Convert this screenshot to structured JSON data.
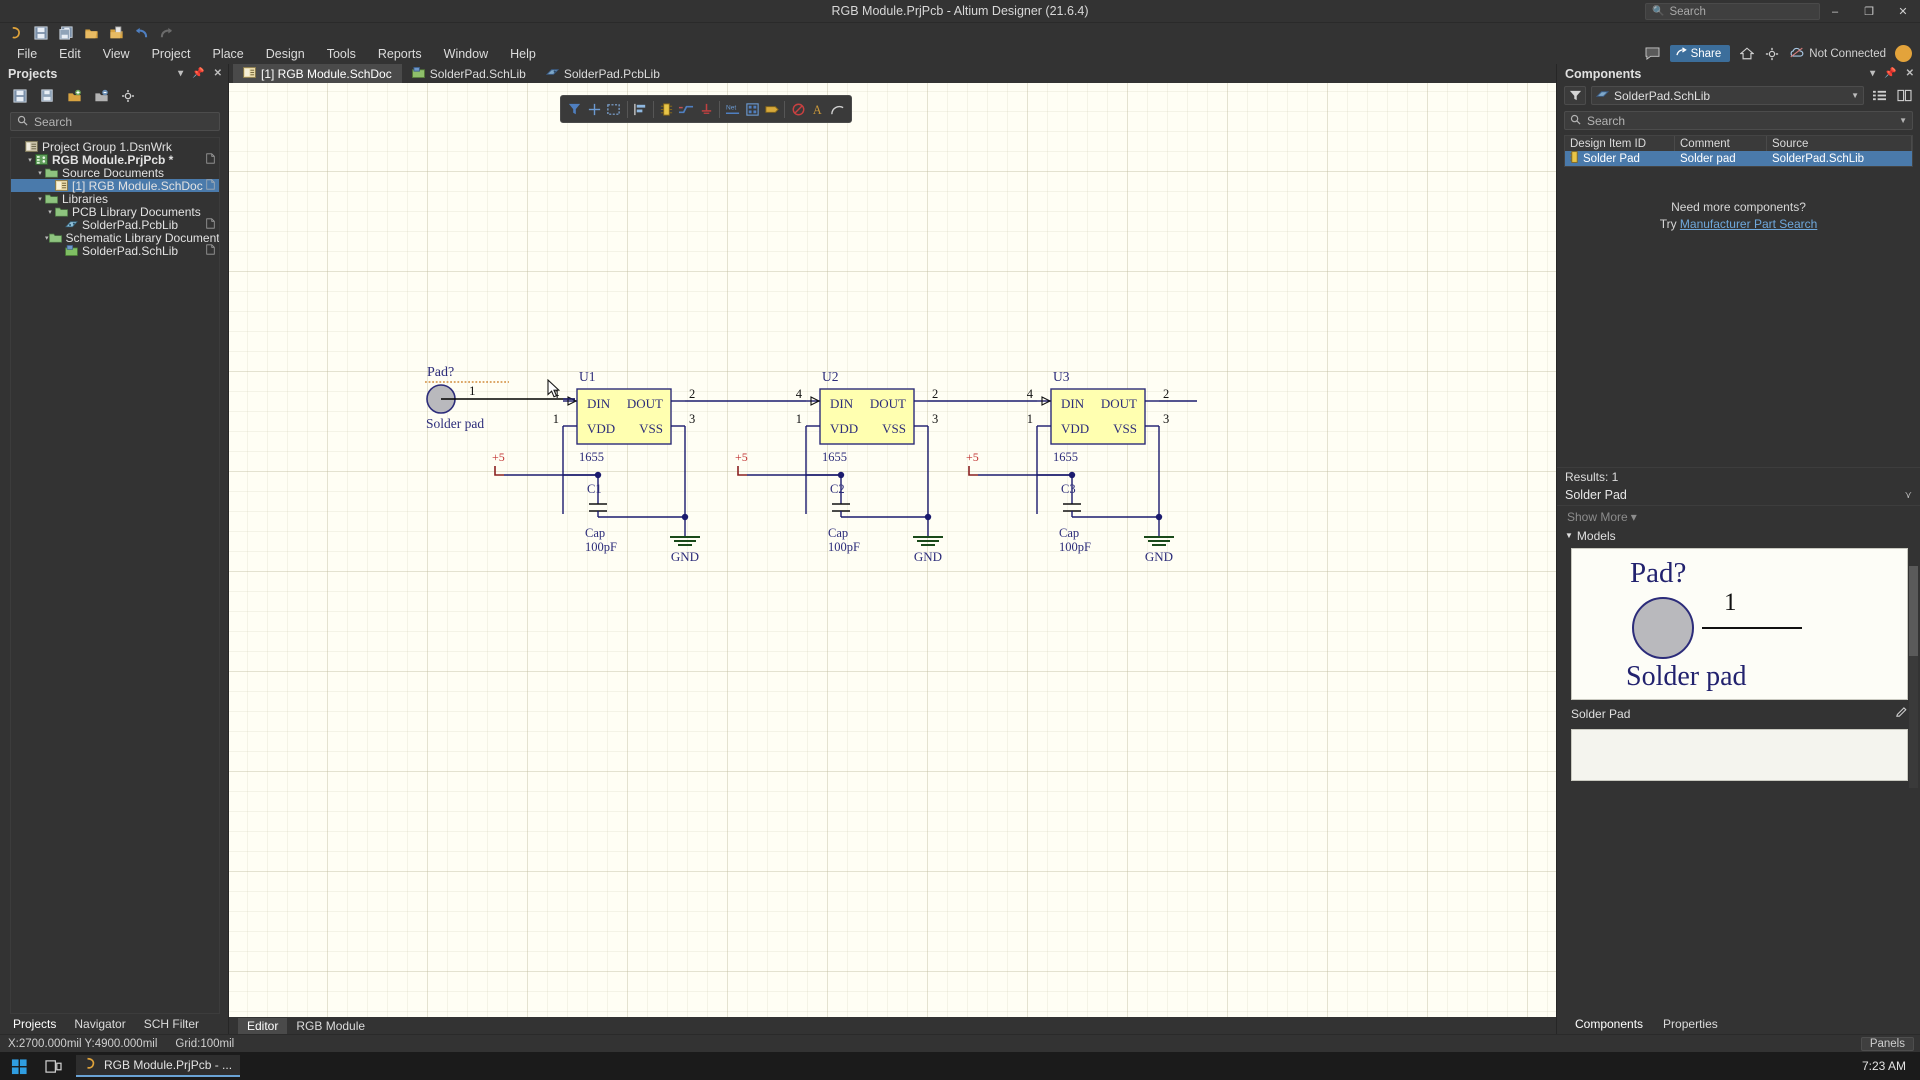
{
  "window": {
    "title": "RGB Module.PrjPcb - Altium Designer (21.6.4)",
    "search_placeholder": "Search",
    "minimize": "–",
    "maximize": "❐",
    "close": "✕"
  },
  "quickbar": {
    "items": [
      {
        "name": "altium-logo-icon",
        "glyph": "A"
      },
      {
        "name": "save-icon",
        "glyph": "save"
      },
      {
        "name": "save-all-icon",
        "glyph": "save-all"
      },
      {
        "name": "open-icon",
        "glyph": "folder"
      },
      {
        "name": "open-project-icon",
        "glyph": "folder-doc"
      },
      {
        "name": "undo-icon",
        "glyph": "↶"
      },
      {
        "name": "redo-icon",
        "glyph": "↷"
      }
    ]
  },
  "menu": {
    "items": [
      "File",
      "Edit",
      "View",
      "Project",
      "Place",
      "Design",
      "Tools",
      "Reports",
      "Window",
      "Help"
    ],
    "share_label": "Share",
    "connection_status": "Not Connected",
    "right_icons": [
      "comment-icon",
      "share-icon",
      "home-icon",
      "gear-icon",
      "cloud-icon"
    ]
  },
  "projects_panel": {
    "title": "Projects",
    "header_controls": [
      "chevron-down-icon",
      "pin-icon",
      "close-icon"
    ],
    "toolbar_icons": [
      "save-icon",
      "save-all-icon",
      "open-project-icon",
      "close-project-icon",
      "options-icon"
    ],
    "search_placeholder": "Search",
    "tree": [
      {
        "label": "Project Group 1.DsnWrk",
        "indent": 0,
        "arrow": "",
        "icon": "workspace-icon",
        "bold": false,
        "selected": false,
        "doc_icon": false
      },
      {
        "label": "RGB Module.PrjPcb *",
        "indent": 1,
        "arrow": "▾",
        "icon": "project-icon",
        "bold": true,
        "selected": false,
        "doc_icon": true
      },
      {
        "label": "Source Documents",
        "indent": 2,
        "arrow": "▾",
        "icon": "folder-icon",
        "bold": false,
        "selected": false,
        "doc_icon": false
      },
      {
        "label": "[1] RGB Module.SchDoc",
        "indent": 3,
        "arrow": "",
        "icon": "schdoc-icon",
        "bold": false,
        "selected": true,
        "doc_icon": true
      },
      {
        "label": "Libraries",
        "indent": 2,
        "arrow": "▾",
        "icon": "folder-icon",
        "bold": false,
        "selected": false,
        "doc_icon": false
      },
      {
        "label": "PCB Library Documents",
        "indent": 3,
        "arrow": "▾",
        "icon": "folder-icon",
        "bold": false,
        "selected": false,
        "doc_icon": false
      },
      {
        "label": "SolderPad.PcbLib",
        "indent": 4,
        "arrow": "",
        "icon": "pcblib-icon",
        "bold": false,
        "selected": false,
        "doc_icon": true
      },
      {
        "label": "Schematic Library Documents",
        "indent": 3,
        "arrow": "▾",
        "icon": "folder-icon",
        "bold": false,
        "selected": false,
        "doc_icon": false
      },
      {
        "label": "SolderPad.SchLib",
        "indent": 4,
        "arrow": "",
        "icon": "schlib-icon",
        "bold": false,
        "selected": false,
        "doc_icon": true
      }
    ],
    "tabs": [
      {
        "label": "Projects",
        "active": true
      },
      {
        "label": "Navigator",
        "active": false
      },
      {
        "label": "SCH Filter",
        "active": false
      }
    ]
  },
  "document_tabs": [
    {
      "label": "[1] RGB Module.SchDoc",
      "icon": "schdoc-icon",
      "active": true
    },
    {
      "label": "SolderPad.SchLib",
      "icon": "schlib-icon",
      "active": false
    },
    {
      "label": "SolderPad.PcbLib",
      "icon": "pcblib-icon",
      "active": false
    }
  ],
  "sch_toolbar": {
    "icons": [
      "filter-icon",
      "crosshair-icon",
      "select-area-icon",
      "align-icon",
      "component-icon",
      "wire-icon",
      "power-port-icon",
      "net-label-icon",
      "bus-icon",
      "port-icon",
      "no-erc-icon",
      "text-string-icon",
      "arc-icon"
    ]
  },
  "schematic": {
    "pad": {
      "designator": "Pad?",
      "name": "Solder pad",
      "pin": "1"
    },
    "ics": [
      {
        "designator": "U1",
        "value": "1655",
        "pins": {
          "din": "DIN",
          "dout": "DOUT",
          "vdd": "VDD",
          "vss": "VSS"
        },
        "pin_numbers": {
          "din": "4",
          "dout": "2",
          "vdd": "1",
          "vss": "3"
        },
        "power": "+5",
        "cap_ref": "C1",
        "cap_type": "Cap",
        "cap_value": "100pF",
        "gnd": "GND"
      },
      {
        "designator": "U2",
        "value": "1655",
        "pins": {
          "din": "DIN",
          "dout": "DOUT",
          "vdd": "VDD",
          "vss": "VSS"
        },
        "pin_numbers": {
          "din": "4",
          "dout": "2",
          "vdd": "1",
          "vss": "3"
        },
        "power": "+5",
        "cap_ref": "C2",
        "cap_type": "Cap",
        "cap_value": "100pF",
        "gnd": "GND"
      },
      {
        "designator": "U3",
        "value": "1655",
        "pins": {
          "din": "DIN",
          "dout": "DOUT",
          "vdd": "VDD",
          "vss": "VSS"
        },
        "pin_numbers": {
          "din": "4",
          "dout": "2",
          "vdd": "1",
          "vss": "3"
        },
        "power": "+5",
        "cap_ref": "C3",
        "cap_type": "Cap",
        "cap_value": "100pF",
        "gnd": "GND"
      }
    ]
  },
  "editor_tabs": [
    {
      "label": "Editor",
      "active": true
    },
    {
      "label": "RGB Module",
      "active": false
    }
  ],
  "components_panel": {
    "title": "Components",
    "header_controls": [
      "chevron-down-icon",
      "pin-icon",
      "close-icon"
    ],
    "library": "SolderPad.SchLib",
    "search_placeholder": "Search",
    "columns": [
      "Design Item ID",
      "Comment",
      "Source"
    ],
    "rows": [
      {
        "design_item_id": "Solder Pad",
        "comment": "Solder pad",
        "source": "SolderPad.SchLib"
      }
    ],
    "empty_hint_line1": "Need more components?",
    "empty_hint_line2_prefix": "Try ",
    "empty_hint_link": "Manufacturer Part Search",
    "results": "Results: 1",
    "selected_component": "Solder Pad",
    "show_more": "Show More",
    "models_label": "Models",
    "preview": {
      "designator": "Pad?",
      "pin": "1",
      "name": "Solder pad"
    },
    "model_name": "Solder Pad",
    "tabs": [
      {
        "label": "Components",
        "active": true
      },
      {
        "label": "Properties",
        "active": false
      }
    ]
  },
  "statusbar": {
    "coords": "X:2700.000mil Y:4900.000mil",
    "grid": "Grid:100mil",
    "panels_button": "Panels"
  },
  "taskbar": {
    "start_icon": "windows-start-icon",
    "task_view_icon": "task-view-icon",
    "app_label": "RGB Module.PrjPcb - ...",
    "clock": "7:23 AM"
  },
  "colors": {
    "accent_blue": "#4a7aab",
    "share_blue": "#3c6e9b",
    "canvas": "#fffef4",
    "ic_fill": "#ffffb0",
    "ic_stroke": "#2c2c7a",
    "wire": "#1b1b6e",
    "panel_bg": "#333333"
  }
}
